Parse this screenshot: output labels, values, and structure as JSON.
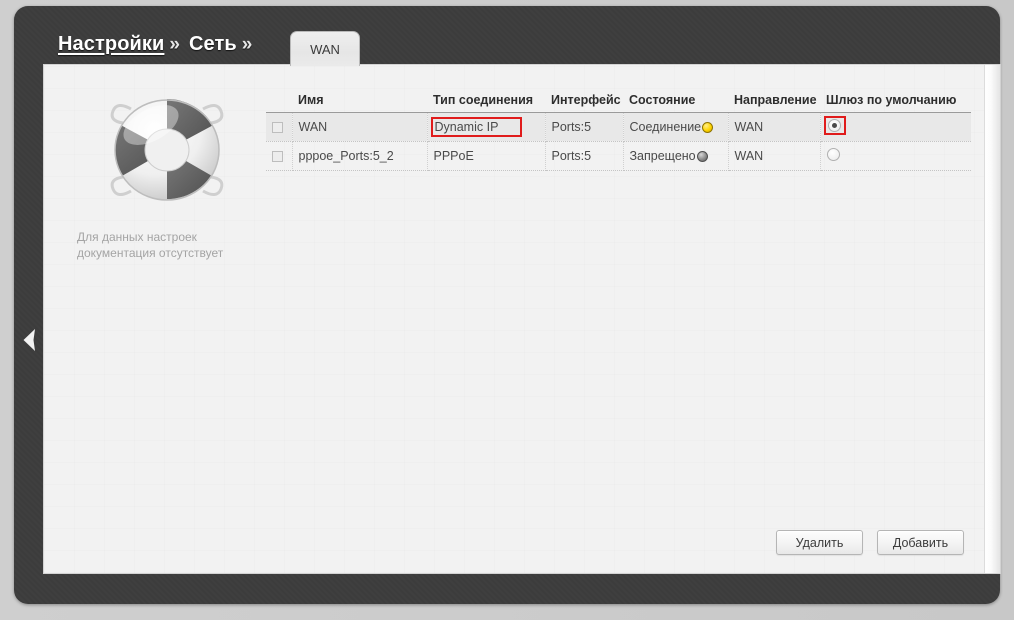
{
  "breadcrumb": {
    "items": [
      {
        "label": "Настройки",
        "separator": "»",
        "link": true
      },
      {
        "label": "Сеть",
        "separator": "»",
        "link": false
      }
    ]
  },
  "tabs": [
    {
      "label": "WAN",
      "active": true
    }
  ],
  "help": {
    "icon": "lifebuoy-icon",
    "line1": "Для данных настроек",
    "line2": "документация отсутствует"
  },
  "table": {
    "headers": {
      "name": "Имя",
      "type": "Тип соединения",
      "interface": "Интерфейс",
      "state": "Состояние",
      "direction": "Направление",
      "gateway": "Шлюз по умолчанию"
    },
    "rows": [
      {
        "checked": false,
        "name": "WAN",
        "type": "Dynamic IP",
        "type_highlighted": true,
        "interface": "Ports:5",
        "state": "Соединение",
        "state_dot": "yellow",
        "direction": "WAN",
        "gateway_selected": true,
        "gateway_highlighted": true
      },
      {
        "checked": false,
        "name": "pppoe_Ports:5_2",
        "type": "PPPoE",
        "type_highlighted": false,
        "interface": "Ports:5",
        "state": "Запрещено",
        "state_dot": "gray",
        "direction": "WAN",
        "gateway_selected": false,
        "gateway_highlighted": false
      }
    ]
  },
  "buttons": {
    "delete": "Удалить",
    "add": "Добавить"
  },
  "colors": {
    "highlight": "#e01b1b",
    "frame": "#3d3d3d",
    "status_connecting": "#ffd400",
    "status_denied": "#8e8e8e"
  },
  "collapse_handle": {
    "icon": "chevron-left-icon"
  }
}
